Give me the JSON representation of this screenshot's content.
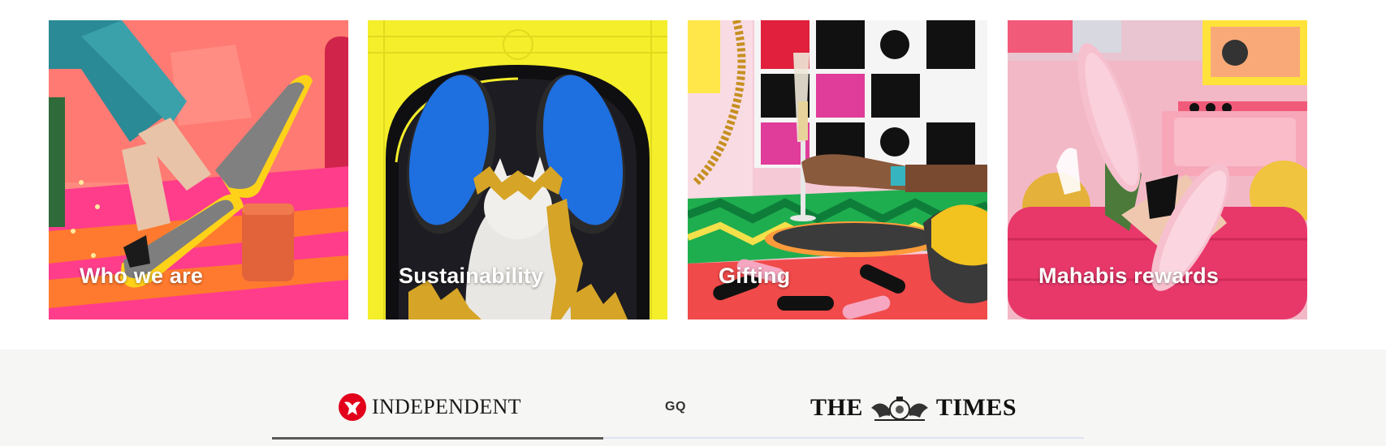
{
  "cards": [
    {
      "label": "Who we are"
    },
    {
      "label": "Sustainability"
    },
    {
      "label": "Gifting"
    },
    {
      "label": "Mahabis rewards"
    }
  ],
  "press": {
    "logos": [
      {
        "name": "INDEPENDENT"
      },
      {
        "name": "GQ"
      },
      {
        "name": "THE",
        "name2": "TIMES"
      }
    ],
    "carousel_progress_percent": 40.8
  },
  "colors": {
    "press_bg": "#f6f6f4",
    "independent_red": "#e2001a",
    "track": "#dfe3f0",
    "track_active": "#5a5a5a"
  }
}
